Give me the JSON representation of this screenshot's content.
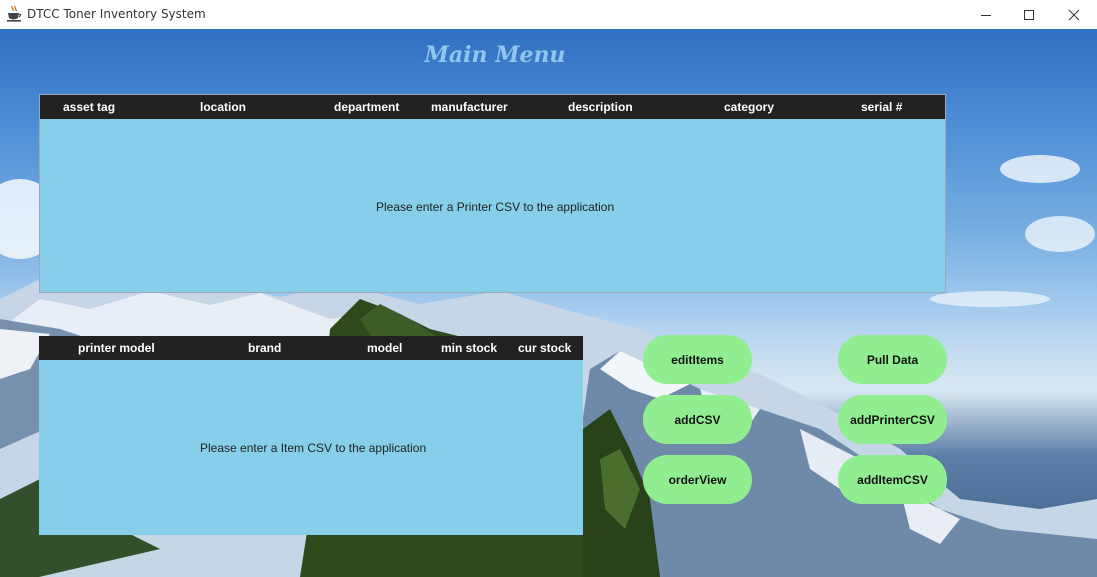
{
  "window": {
    "title": "DTCC Toner Inventory System"
  },
  "page": {
    "title": "Main Menu"
  },
  "printer_table": {
    "columns": [
      "asset tag",
      "location",
      "department",
      "manufacturer",
      "description",
      "category",
      "serial #"
    ],
    "empty_message": "Please enter a Printer CSV to the application"
  },
  "item_table": {
    "columns": [
      "printer model",
      "brand",
      "model",
      "min stock",
      "cur stock"
    ],
    "empty_message": "Please enter a Item CSV to the application"
  },
  "buttons": {
    "edit_items": "editItems",
    "add_csv": "addCSV",
    "order_view": "orderView",
    "pull_data": "Pull Data",
    "add_printer_csv": "addPrinterCSV",
    "add_item_csv": "addItemCSV"
  },
  "colors": {
    "table_bg": "#87ceeb",
    "header_bg": "#222222",
    "button_bg": "#90ee90",
    "title_color": "#8fc5ee"
  }
}
